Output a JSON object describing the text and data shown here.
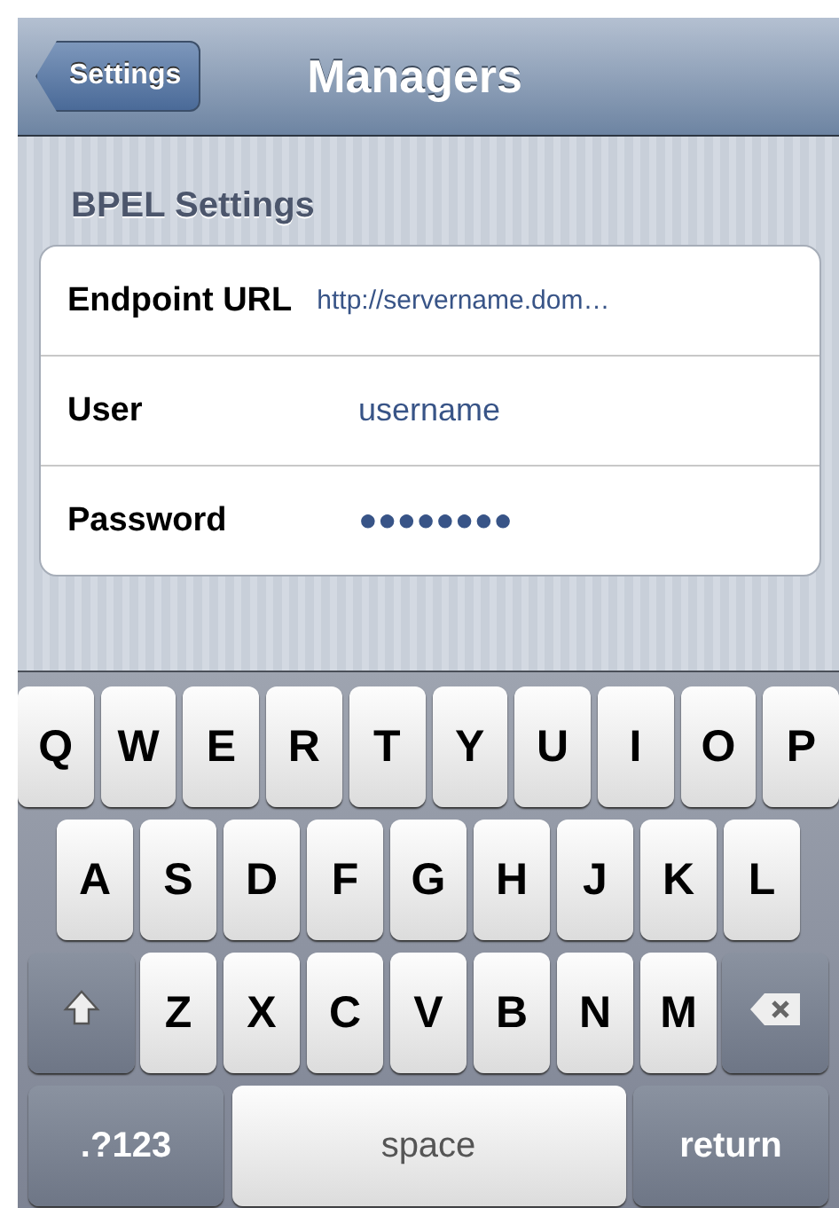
{
  "nav_bar": {
    "back_button": "Settings",
    "title": "Managers"
  },
  "sections": [
    {
      "header": "BPEL Settings",
      "rows": [
        {
          "label": "Endpoint URL",
          "value": "http://servername.dom…"
        },
        {
          "label": "User",
          "value": "username"
        },
        {
          "label": "Password",
          "value": "●●●●●●●●"
        }
      ]
    }
  ],
  "keyboard": {
    "rows": [
      [
        "Q",
        "W",
        "E",
        "R",
        "T",
        "Y",
        "U",
        "I",
        "O",
        "P"
      ],
      [
        "A",
        "S",
        "D",
        "F",
        "G",
        "H",
        "J",
        "K",
        "L"
      ],
      [
        "Z",
        "X",
        "C",
        "V",
        "B",
        "N",
        "M"
      ]
    ],
    "bottom_keys": [
      {
        "label": ".?123",
        "kind": "mode"
      },
      {
        "label": "space",
        "kind": "space"
      },
      {
        "label": "return",
        "kind": "return"
      }
    ]
  }
}
